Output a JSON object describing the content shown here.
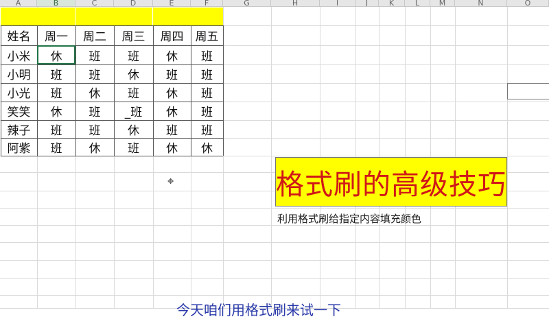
{
  "columns": [
    "A",
    "B",
    "C",
    "D",
    "E",
    "F",
    "G",
    "H",
    "I",
    "J",
    "K",
    "L",
    "M",
    "N",
    "O"
  ],
  "table": {
    "headers": [
      "姓名",
      "周一",
      "周二",
      "周三",
      "周四",
      "周五"
    ],
    "rows": [
      [
        "小米",
        "休",
        "班",
        "班",
        "休",
        "班"
      ],
      [
        "小明",
        "班",
        "班",
        "休",
        "班",
        "班"
      ],
      [
        "小光",
        "班",
        "休",
        "班",
        "休",
        "班"
      ],
      [
        "笑笑",
        "休",
        "班",
        "_班",
        "休",
        "班"
      ],
      [
        "辣子",
        "班",
        "班",
        "休",
        "班",
        "班"
      ],
      [
        "阿紫",
        "班",
        "休",
        "班",
        "休",
        "休"
      ]
    ]
  },
  "banner": {
    "title": "格式刷的高级技巧",
    "subtitle": "利用格式刷给指定内容填充颜色"
  },
  "caption": "今天咱们用格式刷来试一下",
  "cursor_symbol": "✥",
  "colors": {
    "highlight": "#ffff00",
    "title_text": "#d01818",
    "caption_text": "#2a3aa8",
    "selection": "#217346"
  }
}
